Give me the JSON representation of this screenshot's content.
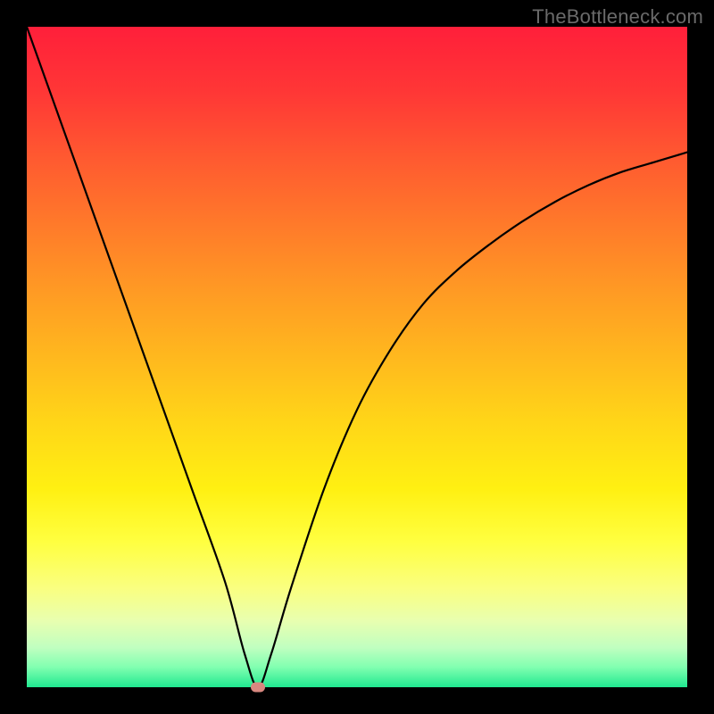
{
  "watermark": "TheBottleneck.com",
  "chart_data": {
    "type": "line",
    "title": "",
    "xlabel": "",
    "ylabel": "",
    "xlim": [
      0,
      100
    ],
    "ylim": [
      0,
      100
    ],
    "series": [
      {
        "name": "curve",
        "x": [
          0,
          5,
          10,
          15,
          20,
          25,
          30,
          33,
          35,
          37,
          40,
          45,
          50,
          55,
          60,
          65,
          70,
          75,
          80,
          85,
          90,
          95,
          100
        ],
        "y": [
          100,
          86,
          72,
          58,
          44,
          30,
          16,
          5,
          0,
          5,
          15,
          30,
          42,
          51,
          58,
          63,
          67,
          70.5,
          73.5,
          76,
          78,
          79.5,
          81
        ]
      }
    ],
    "marker": {
      "x": 35,
      "y": 0,
      "color": "#d98880"
    },
    "background_gradient": {
      "stops": [
        {
          "offset": 0.0,
          "color": "#ff1f3a"
        },
        {
          "offset": 0.1,
          "color": "#ff3736"
        },
        {
          "offset": 0.2,
          "color": "#ff5a30"
        },
        {
          "offset": 0.3,
          "color": "#ff7a2a"
        },
        {
          "offset": 0.4,
          "color": "#ff9a24"
        },
        {
          "offset": 0.5,
          "color": "#ffb81e"
        },
        {
          "offset": 0.6,
          "color": "#ffd618"
        },
        {
          "offset": 0.7,
          "color": "#fff012"
        },
        {
          "offset": 0.78,
          "color": "#ffff40"
        },
        {
          "offset": 0.85,
          "color": "#faff80"
        },
        {
          "offset": 0.9,
          "color": "#e8ffb0"
        },
        {
          "offset": 0.94,
          "color": "#c0ffc0"
        },
        {
          "offset": 0.97,
          "color": "#80ffb0"
        },
        {
          "offset": 1.0,
          "color": "#20e890"
        }
      ]
    }
  }
}
